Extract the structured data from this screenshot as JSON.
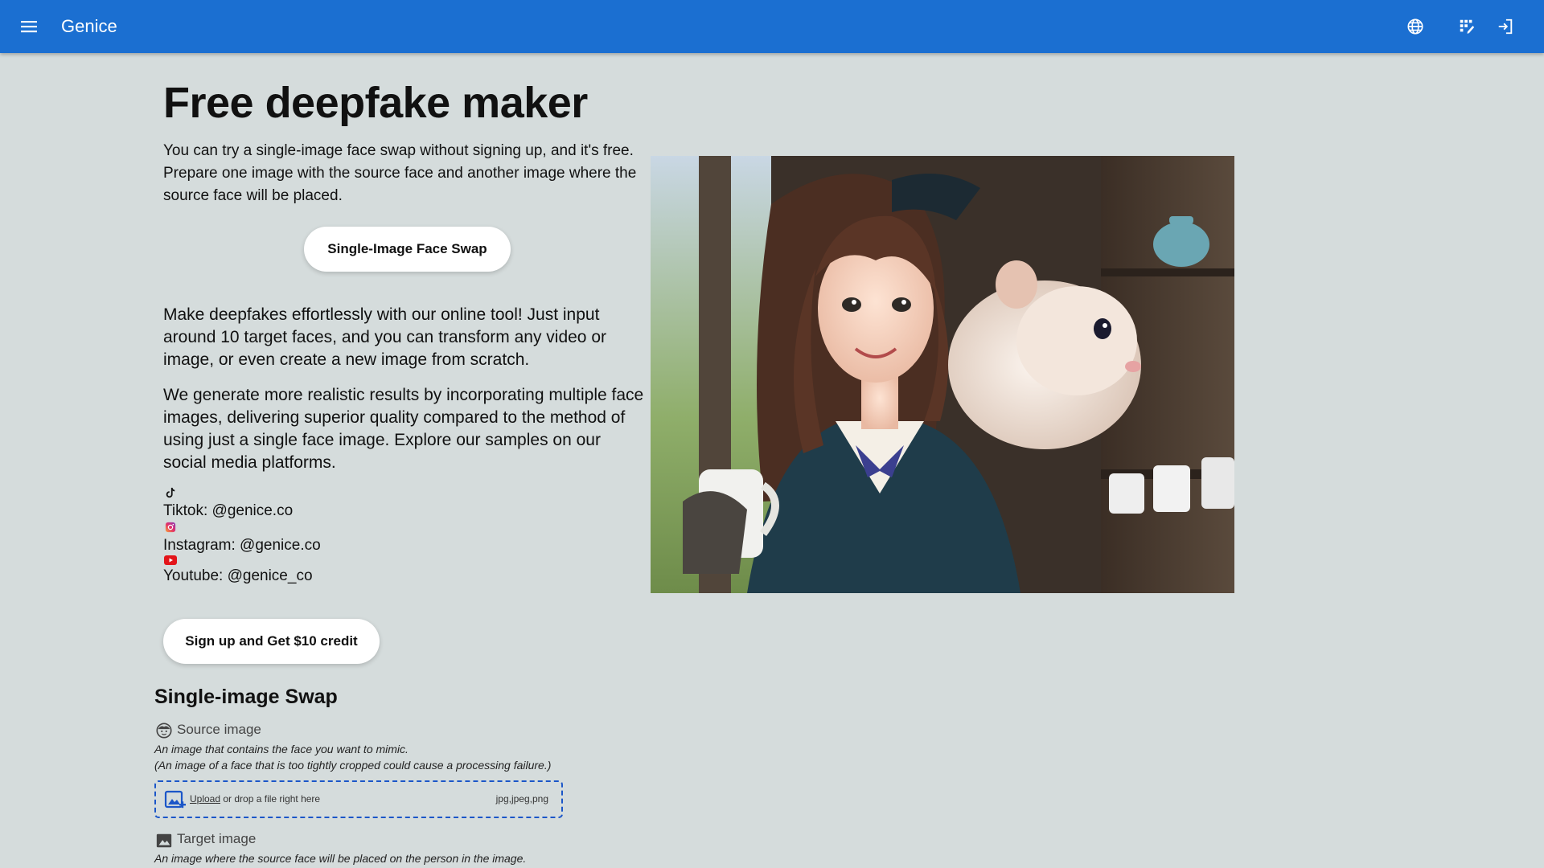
{
  "appbar": {
    "brand": "Genice",
    "icons": [
      "menu-icon",
      "globe-icon",
      "dashboard-icon",
      "login-icon"
    ],
    "color": "#1b6fd1"
  },
  "hero": {
    "title": "Free deepfake maker",
    "intro": "You can try a single-image face swap without signing up, and it's free. Prepare one image with the source face and another image where the source face will be placed.",
    "swap_button": "Single-Image Face Swap",
    "para1": "Make deepfakes effortlessly with our online tool! Just input around 10 target faces, and you can transform any video or image, or even create a new image from scratch.",
    "para2": "We generate more realistic results by incorporating multiple face images, delivering superior quality compared to the method of using just a single face image. Explore our samples on our social media platforms."
  },
  "social": {
    "tiktok": "Tiktok: @genice.co",
    "instagram": "Instagram: @genice.co",
    "youtube": "Youtube: @genice_co"
  },
  "signup_button": "Sign up and Get $10 credit",
  "single_swap": {
    "title": "Single-image Swap",
    "source_label": "Source image",
    "source_hint1": "An image that contains the face you want to mimic.",
    "source_hint2": "(An image of a face that is too tightly cropped could cause a processing failure.)",
    "upload_link": "Upload",
    "upload_rest": " or drop a file right here",
    "file_types": "jpg,jpeg,png",
    "target_label": "Target image",
    "target_hint": "An image where the source face will be placed on the person in the image."
  }
}
